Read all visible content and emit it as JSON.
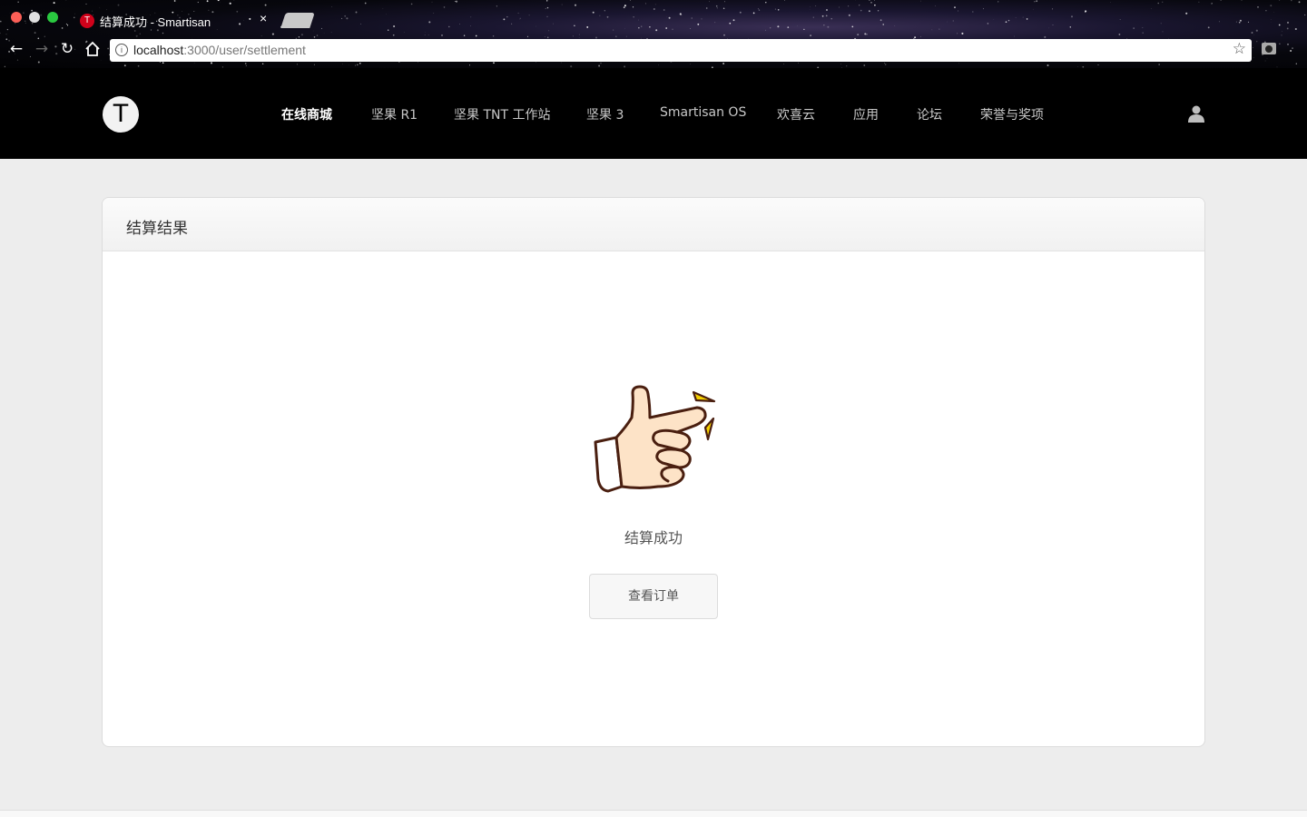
{
  "browser": {
    "tab_favicon": "T",
    "tab_title": "结算成功 - Smartisan",
    "tab_close": "×",
    "url_host": "localhost",
    "url_path": ":3000/user/settlement",
    "icons": [
      "back-arrow-icon",
      "forward-arrow-icon",
      "reload-icon",
      "home-icon",
      "info-icon",
      "bookmark-star-icon",
      "camera-icon"
    ]
  },
  "header": {
    "logo": "T",
    "nav": [
      {
        "label": "在线商城",
        "active": true
      },
      {
        "label": "坚果 R1"
      },
      {
        "label": "坚果 TNT 工作站"
      },
      {
        "label": "坚果 3"
      },
      {
        "label": "Smartisan OS"
      },
      {
        "label": "欢喜云"
      },
      {
        "label": "应用"
      },
      {
        "label": "论坛"
      },
      {
        "label": "荣誉与奖项"
      }
    ],
    "user_icon": "user-icon"
  },
  "panel": {
    "title": "结算结果",
    "illustration": "snapping-hand-icon",
    "result_text": "结算成功",
    "button_label": "查看订单"
  }
}
